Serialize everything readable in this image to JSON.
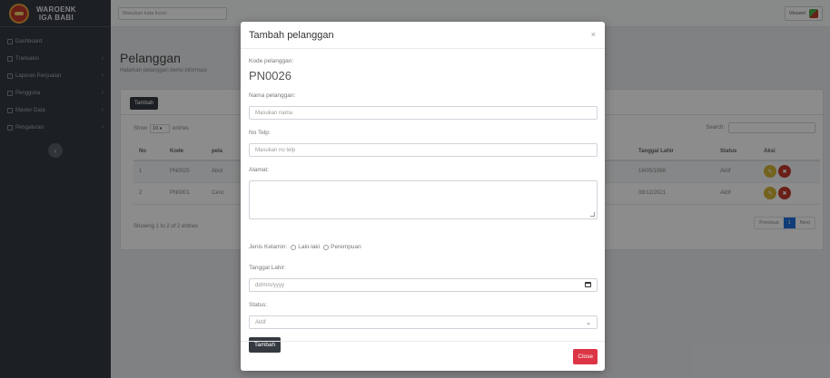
{
  "brand": {
    "line1": "WAROENK",
    "line2": "IGA BABI"
  },
  "sidebar": {
    "items": [
      {
        "label": "Dashboard",
        "arrow": ""
      },
      {
        "label": "Transaksi",
        "arrow": "›"
      },
      {
        "label": "Laporan Penjualan",
        "arrow": "›"
      },
      {
        "label": "Pengguna",
        "arrow": "›"
      },
      {
        "label": "Master Data",
        "arrow": "›"
      },
      {
        "label": "Pengaturan",
        "arrow": "›"
      }
    ],
    "collapse_icon": "‹"
  },
  "topbar": {
    "search_placeholder": "Masukan kata kunci",
    "user_name": "Vincent"
  },
  "page": {
    "title": "Pelanggan",
    "subtitle": "Halaman pelanggan berisi informasi"
  },
  "card": {
    "add_button": "Tambah",
    "show_prefix": "Show",
    "show_value": "10 ♦",
    "show_suffix": "entries",
    "search_label": "Search:",
    "table": {
      "headers": [
        "No",
        "Kode",
        "pela",
        "Tanggal Lahir",
        "Status",
        "Aksi"
      ],
      "rows": [
        {
          "no": "1",
          "kode": "PN0025",
          "nama": "Abol",
          "tgl": "16/05/1988",
          "status": "Aktif"
        },
        {
          "no": "2",
          "kode": "PN0001",
          "nama": "Cenc",
          "tgl": "08/12/2021",
          "status": "Aktif"
        }
      ]
    },
    "showing_text": "Showing 1 to 2 of 2 entries",
    "pager": {
      "previous": "Previous",
      "page": "1",
      "next": "Next"
    }
  },
  "modal": {
    "title": "Tambah pelanggan",
    "close_x": "×",
    "kode_label": "Kode pelanggan:",
    "kode_value": "PN0026",
    "nama_label": "Nama pelanggan:",
    "nama_placeholder": "Masukan nama",
    "telp_label": "No Telp:",
    "telp_placeholder": "Masukan no telp",
    "alamat_label": "Alamat:",
    "gender_label": "Jenis Kelamin:",
    "gender_options": [
      "Laki-laki",
      "Perempuan"
    ],
    "tgl_label": "Tanggal Lahir:",
    "tgl_placeholder": "dd/mm/yyyy",
    "status_label": "Status:",
    "status_value": "Aktif",
    "submit_label": "Tambah",
    "close_button": "Close"
  }
}
